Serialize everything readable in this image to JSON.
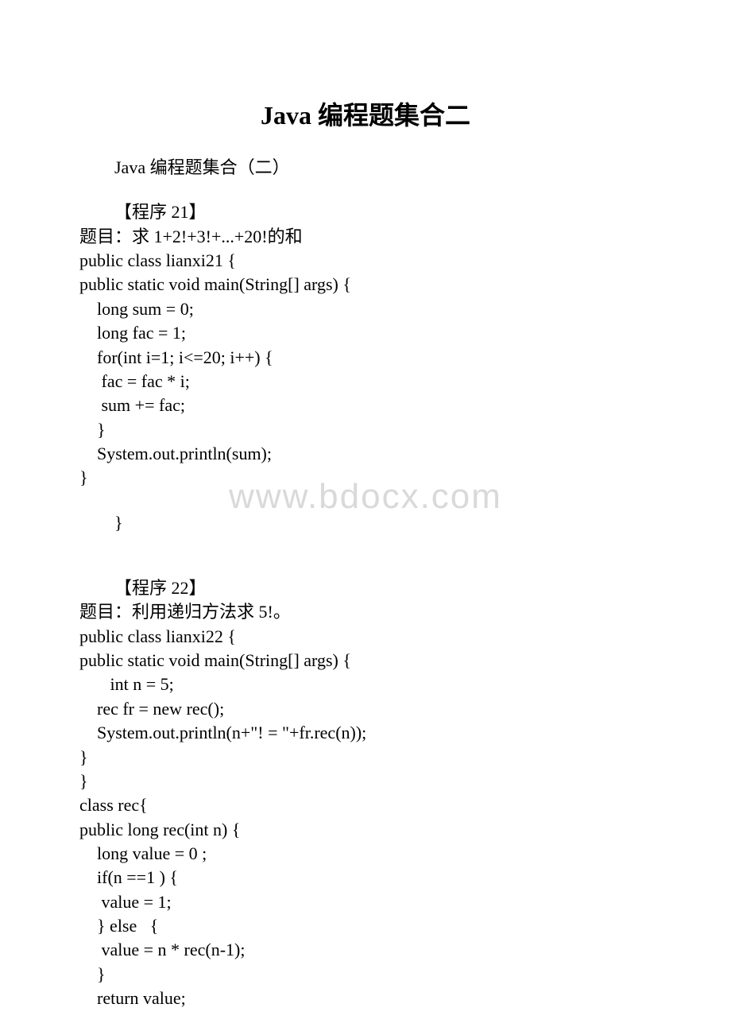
{
  "title": "Java 编程题集合二",
  "watermark": "www.bdocx.com",
  "lines": [
    {
      "text": "Java 编程题集合（二）",
      "cls": "line indent"
    },
    {
      "text": "",
      "cls": "spacer"
    },
    {
      "text": "【程序 21】",
      "cls": "line indent"
    },
    {
      "text": "题目：求 1+2!+3!+...+20!的和",
      "cls": "line"
    },
    {
      "text": "public class lianxi21 {",
      "cls": "line"
    },
    {
      "text": "public static void main(String[] args) {",
      "cls": "line"
    },
    {
      "text": "    long sum = 0;",
      "cls": "line"
    },
    {
      "text": "    long fac = 1;",
      "cls": "line"
    },
    {
      "text": "    for(int i=1; i<=20; i++) {",
      "cls": "line"
    },
    {
      "text": "     fac = fac * i;",
      "cls": "line"
    },
    {
      "text": "     sum += fac;",
      "cls": "line"
    },
    {
      "text": "    }",
      "cls": "line"
    },
    {
      "text": "    System.out.println(sum);",
      "cls": "line"
    },
    {
      "text": "}",
      "cls": "line"
    },
    {
      "text": "",
      "cls": "spacer"
    },
    {
      "text": "}",
      "cls": "line indent"
    },
    {
      "text": "",
      "cls": "spacer"
    },
    {
      "text": "",
      "cls": "spacer"
    },
    {
      "text": "【程序 22】",
      "cls": "line indent"
    },
    {
      "text": "题目：利用递归方法求 5!。",
      "cls": "line"
    },
    {
      "text": "public class lianxi22 {",
      "cls": "line"
    },
    {
      "text": "public static void main(String[] args) {",
      "cls": "line"
    },
    {
      "text": "       int n = 5;",
      "cls": "line"
    },
    {
      "text": "    rec fr = new rec();",
      "cls": "line"
    },
    {
      "text": "    System.out.println(n+\"! = \"+fr.rec(n));",
      "cls": "line"
    },
    {
      "text": "}",
      "cls": "line"
    },
    {
      "text": "}",
      "cls": "line"
    },
    {
      "text": "class rec{",
      "cls": "line"
    },
    {
      "text": "public long rec(int n) {",
      "cls": "line"
    },
    {
      "text": "    long value = 0 ;",
      "cls": "line"
    },
    {
      "text": "    if(n ==1 ) {",
      "cls": "line"
    },
    {
      "text": "     value = 1;",
      "cls": "line"
    },
    {
      "text": "    } else   {",
      "cls": "line"
    },
    {
      "text": "     value = n * rec(n-1);",
      "cls": "line"
    },
    {
      "text": "    }",
      "cls": "line"
    },
    {
      "text": "    return value;",
      "cls": "line"
    }
  ]
}
